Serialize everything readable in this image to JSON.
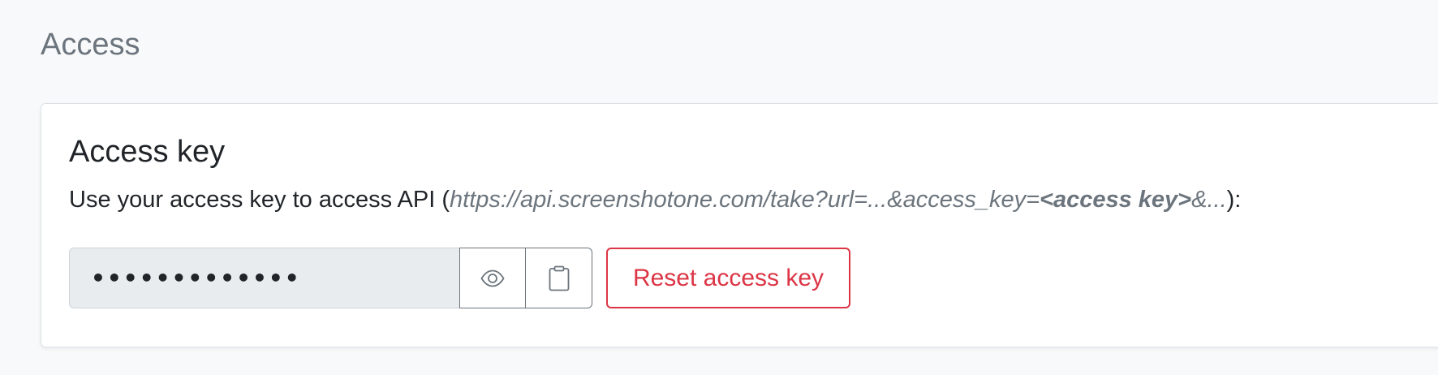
{
  "section": {
    "title": "Access"
  },
  "card": {
    "title": "Access key",
    "description": {
      "prefix": "Use your access key to access API (",
      "url_start": "https://api.screenshotone.com/take?url=...&access_key=",
      "url_key": "<access key>",
      "url_end": "&...",
      "suffix": "):"
    },
    "access_key": {
      "value": "•••••••••••••"
    },
    "buttons": {
      "show_icon": "eye-icon",
      "copy_icon": "clipboard-icon",
      "reset_label": "Reset access key"
    }
  },
  "colors": {
    "danger": "#dc3545",
    "muted": "#6c757d",
    "input_bg": "#e9ecef"
  }
}
